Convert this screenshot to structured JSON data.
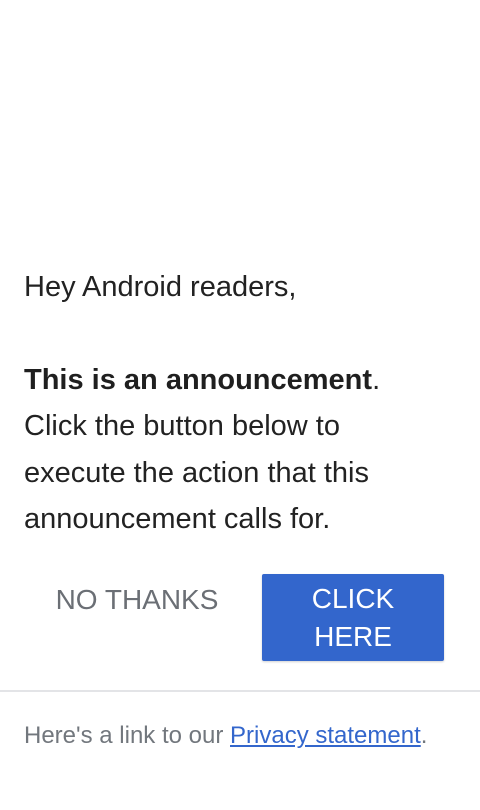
{
  "announcement": {
    "greeting": "Hey Android readers,",
    "headline": "This is an announcement",
    "headline_period": ".",
    "body": "Click the button below to execute the action that this announcement calls for."
  },
  "actions": {
    "dismiss_label": "NO THANKS",
    "primary_label": "CLICK HERE"
  },
  "footer": {
    "prefix": "Here's a link to our ",
    "link_text": "Privacy statement",
    "suffix": "."
  },
  "colors": {
    "accent": "#3366cc",
    "text": "#222222",
    "muted": "#72777d",
    "divider": "#e3e4e7"
  }
}
